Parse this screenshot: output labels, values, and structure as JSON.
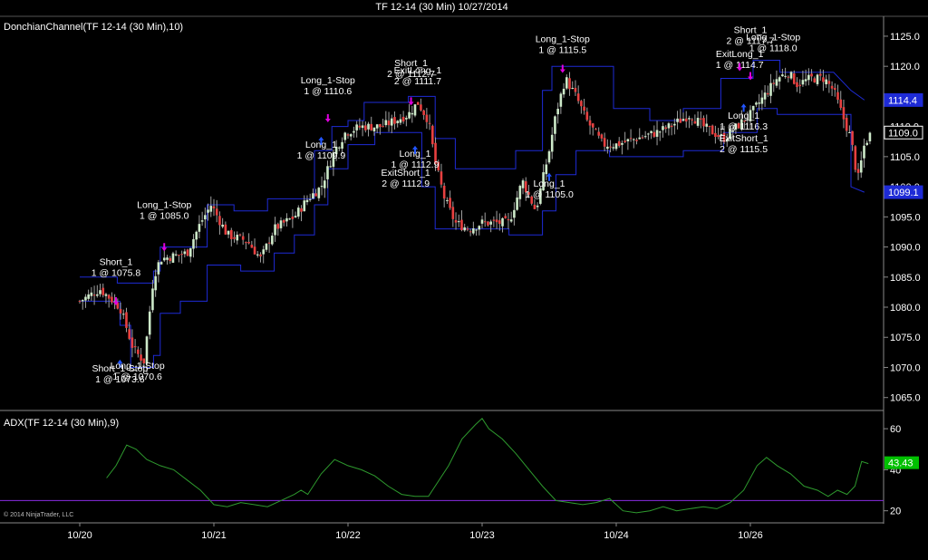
{
  "chart_data": [
    {
      "type": "candlestick",
      "title": "TF 12-14 (30 Min)  10/27/2014",
      "panel_label": "DonchianChannel(TF 12-14 (30 Min),10)",
      "y_ticks": [
        "1065.0",
        "1070.0",
        "1075.0",
        "1080.0",
        "1085.0",
        "1090.0",
        "1095.0",
        "1100.0",
        "1105.0",
        "1110.0",
        "1115.0",
        "1120.0",
        "1125.0"
      ],
      "ylim": [
        1063,
        1128
      ],
      "grid": false,
      "price_badges": [
        {
          "value": 1114.4,
          "label": "1114.4",
          "color": "#1e2bd6"
        },
        {
          "value": 1109.0,
          "label": "1109.0",
          "color": "#ffffff"
        },
        {
          "value": 1099.1,
          "label": "1099.1",
          "color": "#1e2bd6"
        }
      ],
      "price_path": [
        [
          20.0,
          1081
        ],
        [
          20.15,
          1083
        ],
        [
          20.3,
          1080
        ],
        [
          20.4,
          1073
        ],
        [
          20.48,
          1071
        ],
        [
          20.55,
          1085
        ],
        [
          20.6,
          1088
        ],
        [
          20.8,
          1089
        ],
        [
          20.9,
          1094
        ],
        [
          20.98,
          1097
        ],
        [
          21.1,
          1092
        ],
        [
          21.25,
          1091
        ],
        [
          21.35,
          1088
        ],
        [
          21.45,
          1093
        ],
        [
          21.6,
          1095
        ],
        [
          21.7,
          1098
        ],
        [
          21.8,
          1100
        ],
        [
          21.9,
          1106
        ],
        [
          21.98,
          1109
        ],
        [
          22.1,
          1110
        ],
        [
          22.25,
          1110
        ],
        [
          22.35,
          1111
        ],
        [
          22.45,
          1112
        ],
        [
          22.52,
          1114
        ],
        [
          22.6,
          1111
        ],
        [
          22.65,
          1104
        ],
        [
          22.72,
          1098
        ],
        [
          22.8,
          1094
        ],
        [
          22.9,
          1093
        ],
        [
          23.0,
          1094
        ],
        [
          23.1,
          1094
        ],
        [
          23.2,
          1094
        ],
        [
          23.3,
          1101
        ],
        [
          23.4,
          1096
        ],
        [
          23.5,
          1106
        ],
        [
          23.55,
          1112
        ],
        [
          23.62,
          1118
        ],
        [
          23.7,
          1115
        ],
        [
          23.78,
          1111
        ],
        [
          23.9,
          1107
        ],
        [
          24.0,
          1107
        ],
        [
          24.15,
          1108
        ],
        [
          24.3,
          1109
        ],
        [
          24.4,
          1110
        ],
        [
          24.55,
          1112
        ],
        [
          24.65,
          1110
        ],
        [
          24.8,
          1108
        ],
        [
          24.9,
          1110
        ],
        [
          25.0,
          1112
        ],
        [
          25.1,
          1115
        ],
        [
          25.2,
          1118
        ],
        [
          25.28,
          1119
        ],
        [
          25.35,
          1117
        ],
        [
          25.45,
          1118
        ],
        [
          25.55,
          1118
        ],
        [
          25.62,
          1116
        ],
        [
          25.7,
          1111
        ],
        [
          25.75,
          1108
        ],
        [
          25.8,
          1101
        ],
        [
          25.85,
          1107
        ],
        [
          25.9,
          1109
        ]
      ],
      "channel_upper": [
        [
          20.0,
          1085
        ],
        [
          20.28,
          1085
        ],
        [
          20.28,
          1084
        ],
        [
          20.55,
          1084
        ],
        [
          20.55,
          1086
        ],
        [
          20.6,
          1086
        ],
        [
          20.6,
          1090
        ],
        [
          20.95,
          1090
        ],
        [
          20.95,
          1097
        ],
        [
          21.15,
          1097
        ],
        [
          21.15,
          1096
        ],
        [
          21.4,
          1096
        ],
        [
          21.4,
          1098
        ],
        [
          21.75,
          1098
        ],
        [
          21.75,
          1106
        ],
        [
          21.88,
          1106
        ],
        [
          21.88,
          1110
        ],
        [
          22.0,
          1110
        ],
        [
          22.0,
          1111
        ],
        [
          22.12,
          1111
        ],
        [
          22.12,
          1114
        ],
        [
          22.45,
          1114
        ],
        [
          22.45,
          1115
        ],
        [
          22.65,
          1115
        ],
        [
          22.65,
          1108
        ],
        [
          22.8,
          1108
        ],
        [
          22.8,
          1103
        ],
        [
          23.25,
          1103
        ],
        [
          23.25,
          1106
        ],
        [
          23.45,
          1106
        ],
        [
          23.45,
          1116
        ],
        [
          23.52,
          1116
        ],
        [
          23.52,
          1120
        ],
        [
          23.98,
          1120
        ],
        [
          23.98,
          1113
        ],
        [
          24.25,
          1113
        ],
        [
          24.25,
          1111
        ],
        [
          24.5,
          1111
        ],
        [
          24.5,
          1113
        ],
        [
          24.78,
          1113
        ],
        [
          24.78,
          1118
        ],
        [
          25.02,
          1118
        ],
        [
          25.02,
          1121
        ],
        [
          25.22,
          1121
        ],
        [
          25.22,
          1119
        ],
        [
          25.62,
          1119
        ],
        [
          25.75,
          1116
        ],
        [
          25.85,
          1114.4
        ]
      ],
      "channel_lower": [
        [
          20.0,
          1081
        ],
        [
          20.3,
          1081
        ],
        [
          20.3,
          1077
        ],
        [
          20.38,
          1077
        ],
        [
          20.38,
          1070
        ],
        [
          20.55,
          1070
        ],
        [
          20.55,
          1072
        ],
        [
          20.6,
          1072
        ],
        [
          20.6,
          1079
        ],
        [
          20.75,
          1079
        ],
        [
          20.75,
          1081
        ],
        [
          20.95,
          1081
        ],
        [
          20.95,
          1087
        ],
        [
          21.2,
          1087
        ],
        [
          21.2,
          1086
        ],
        [
          21.45,
          1086
        ],
        [
          21.45,
          1089
        ],
        [
          21.6,
          1089
        ],
        [
          21.6,
          1092
        ],
        [
          21.75,
          1092
        ],
        [
          21.75,
          1097
        ],
        [
          21.85,
          1097
        ],
        [
          21.85,
          1103
        ],
        [
          22.0,
          1103
        ],
        [
          22.0,
          1107
        ],
        [
          22.2,
          1107
        ],
        [
          22.2,
          1109
        ],
        [
          22.55,
          1109
        ],
        [
          22.55,
          1100
        ],
        [
          22.65,
          1100
        ],
        [
          22.65,
          1093
        ],
        [
          23.2,
          1093
        ],
        [
          23.2,
          1092
        ],
        [
          23.45,
          1092
        ],
        [
          23.45,
          1096
        ],
        [
          23.55,
          1096
        ],
        [
          23.55,
          1102
        ],
        [
          23.7,
          1102
        ],
        [
          23.7,
          1106
        ],
        [
          23.95,
          1106
        ],
        [
          23.95,
          1105
        ],
        [
          24.5,
          1105
        ],
        [
          24.5,
          1106
        ],
        [
          24.8,
          1106
        ],
        [
          24.8,
          1109
        ],
        [
          25.05,
          1109
        ],
        [
          25.05,
          1113
        ],
        [
          25.2,
          1113
        ],
        [
          25.2,
          1112
        ],
        [
          25.75,
          1112
        ],
        [
          25.75,
          1100
        ],
        [
          25.85,
          1099.1
        ]
      ],
      "annotations": [
        {
          "name": "Long_1-Stop",
          "lines": [
            "Long_1-Stop",
            "1 @ 1085.0"
          ],
          "x": 20.63,
          "y": 1096.5,
          "marker": "down",
          "my": 1089.6
        },
        {
          "name": "Short_1",
          "lines": [
            "Short_1",
            "1 @ 1075.8"
          ],
          "x": 20.27,
          "y": 1087.0,
          "marker": "down",
          "my": 1080.6
        },
        {
          "name": "Short_1-Stop",
          "lines": [
            "Short_1-Stop",
            "1 @ 1073.6"
          ],
          "x": 20.3,
          "y": 1069.3,
          "marker": "up",
          "my": 1071.0
        },
        {
          "name": "Long_1-Stop",
          "lines": [
            "Long_1-Stop",
            "1 @ 1070.6"
          ],
          "x": 20.43,
          "y": 1069.8,
          "marker": "none",
          "my": 0
        },
        {
          "name": "Long_1-Stop",
          "lines": [
            "Long_1-Stop",
            "1 @ 1110.6"
          ],
          "x": 21.85,
          "y": 1117.2,
          "marker": "down",
          "my": 1111.0
        },
        {
          "name": "Long_1",
          "lines": [
            "Long_1",
            "1 @ 1109.9"
          ],
          "x": 21.8,
          "y": 1106.5,
          "marker": "up",
          "my": 1108.0
        },
        {
          "name": "Short_1",
          "lines": [
            "Short_1",
            "2 @ 1112.7"
          ],
          "x": 22.47,
          "y": 1120.0,
          "marker": "down",
          "my": 1113.8
        },
        {
          "name": "ExitLong_1",
          "lines": [
            "ExitLong_1",
            "2 @ 1111.7"
          ],
          "x": 22.52,
          "y": 1118.8,
          "marker": "none",
          "my": 0
        },
        {
          "name": "Long_1",
          "lines": [
            "Long_1",
            "1 @ 1112.9"
          ],
          "x": 22.5,
          "y": 1105.0,
          "marker": "up",
          "my": 1106.5
        },
        {
          "name": "ExitShort_1",
          "lines": [
            "ExitShort_1",
            "2 @ 1112.9"
          ],
          "x": 22.43,
          "y": 1101.8,
          "marker": "none",
          "my": 0
        },
        {
          "name": "Long_1-Stop",
          "lines": [
            "Long_1-Stop",
            "1 @ 1115.5"
          ],
          "x": 23.6,
          "y": 1124.0,
          "marker": "down",
          "my": 1119.2
        },
        {
          "name": "Long_1",
          "lines": [
            "Long_1",
            "1 @ 1105.0"
          ],
          "x": 23.5,
          "y": 1100.0,
          "marker": "up",
          "my": 1102.0
        },
        {
          "name": "Short_1",
          "lines": [
            "Short_1",
            "2 @ 1117.7"
          ],
          "x": 25.0,
          "y": 1125.5,
          "marker": "down",
          "my": 1118.0
        },
        {
          "name": "Long_1-Stop",
          "lines": [
            "Long_1-Stop",
            "1 @ 1118.0"
          ],
          "x": 25.17,
          "y": 1124.3,
          "marker": "none",
          "my": 0
        },
        {
          "name": "ExitLong_1",
          "lines": [
            "ExitLong_1",
            "1 @ 1114.7"
          ],
          "x": 24.92,
          "y": 1121.5,
          "marker": "down",
          "my": 1119.5
        },
        {
          "name": "Long_1",
          "lines": [
            "Long_1",
            "1 @ 1116.3"
          ],
          "x": 24.95,
          "y": 1111.3,
          "marker": "up",
          "my": 1113.5
        },
        {
          "name": "ExitShort_1",
          "lines": [
            "ExitShort_1",
            "2 @ 1115.5"
          ],
          "x": 24.95,
          "y": 1107.5,
          "marker": "none",
          "my": 0
        }
      ]
    },
    {
      "type": "line",
      "panel_label": "ADX(TF 12-14 (30 Min),9)",
      "y_ticks": [
        "20",
        "40",
        "60"
      ],
      "ylim": [
        15,
        68
      ],
      "reference_line": 25,
      "value_badge": {
        "value": 43.43,
        "label": "43.43",
        "color": "#00c000"
      },
      "series": [
        {
          "color": "#2e9a2e",
          "points": [
            [
              20.2,
              36
            ],
            [
              20.27,
              42
            ],
            [
              20.35,
              52
            ],
            [
              20.42,
              50
            ],
            [
              20.5,
              45
            ],
            [
              20.6,
              42
            ],
            [
              20.7,
              40
            ],
            [
              20.8,
              35
            ],
            [
              20.9,
              30
            ],
            [
              21.0,
              23
            ],
            [
              21.1,
              22
            ],
            [
              21.2,
              24
            ],
            [
              21.3,
              23
            ],
            [
              21.4,
              22
            ],
            [
              21.5,
              25
            ],
            [
              21.6,
              28
            ],
            [
              21.65,
              30
            ],
            [
              21.7,
              28
            ],
            [
              21.8,
              38
            ],
            [
              21.9,
              45
            ],
            [
              22.0,
              42
            ],
            [
              22.1,
              40
            ],
            [
              22.2,
              37
            ],
            [
              22.3,
              32
            ],
            [
              22.4,
              28
            ],
            [
              22.5,
              27
            ],
            [
              22.6,
              27
            ],
            [
              22.75,
              42
            ],
            [
              22.85,
              55
            ],
            [
              22.95,
              62
            ],
            [
              23.0,
              65
            ],
            [
              23.05,
              60
            ],
            [
              23.15,
              55
            ],
            [
              23.25,
              48
            ],
            [
              23.35,
              40
            ],
            [
              23.45,
              32
            ],
            [
              23.55,
              25
            ],
            [
              23.65,
              24
            ],
            [
              23.75,
              23
            ],
            [
              23.85,
              24
            ],
            [
              23.95,
              26
            ],
            [
              24.05,
              20
            ],
            [
              24.15,
              19
            ],
            [
              24.25,
              20
            ],
            [
              24.35,
              22
            ],
            [
              24.45,
              20
            ],
            [
              24.55,
              21
            ],
            [
              24.65,
              22
            ],
            [
              24.75,
              21
            ],
            [
              24.85,
              24
            ],
            [
              24.95,
              30
            ],
            [
              25.05,
              42
            ],
            [
              25.12,
              46
            ],
            [
              25.2,
              42
            ],
            [
              25.3,
              38
            ],
            [
              25.4,
              32
            ],
            [
              25.5,
              30
            ],
            [
              25.58,
              27
            ],
            [
              25.65,
              30
            ],
            [
              25.72,
              28
            ],
            [
              25.78,
              32
            ],
            [
              25.83,
              44
            ],
            [
              25.88,
              43
            ]
          ]
        }
      ]
    }
  ],
  "x_axis": {
    "labels": [
      "10/20",
      "10/21",
      "10/22",
      "10/23",
      "10/24",
      "10/26"
    ],
    "positions": [
      20.0,
      21.0,
      22.0,
      23.0,
      24.0,
      25.0
    ]
  },
  "copyright": "© 2014 NinjaTrader, LLC",
  "colors": {
    "background": "#000000",
    "channel": "#1e2bd6",
    "up_candle": "#cde9c9",
    "down_candle": "#e84040",
    "wick": "#a0a0a0",
    "marker_sell": "#e000e0",
    "marker_buy": "#2255ff",
    "adx": "#2e9a2e",
    "reference": "#8a2be2",
    "axis": "#888888"
  }
}
